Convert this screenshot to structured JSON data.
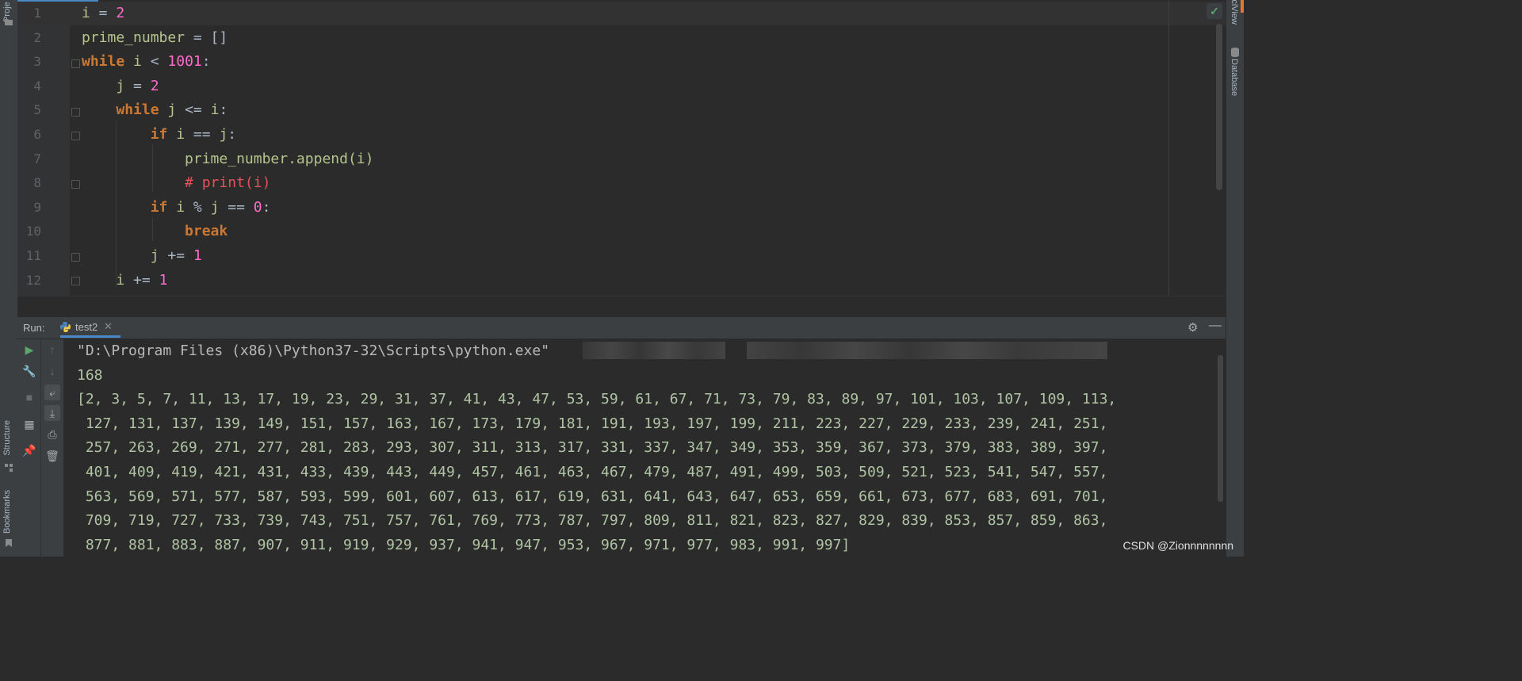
{
  "left_sidebar": {
    "project_label": "Project",
    "structure_label": "Structure",
    "bookmarks_label": "Bookmarks"
  },
  "right_sidebar": {
    "sciview_label": "SciView",
    "database_label": "Database"
  },
  "editor": {
    "lines": [
      {
        "number": "1",
        "tokens": [
          {
            "t": "i",
            "c": "var"
          },
          {
            "t": " = ",
            "c": ""
          },
          {
            "t": "2",
            "c": "num"
          }
        ]
      },
      {
        "number": "2",
        "tokens": [
          {
            "t": "prime_number",
            "c": "var"
          },
          {
            "t": " = []",
            "c": ""
          }
        ]
      },
      {
        "number": "3",
        "tokens": [
          {
            "t": "while",
            "c": "kw"
          },
          {
            "t": " ",
            "c": ""
          },
          {
            "t": "i",
            "c": "var"
          },
          {
            "t": " < ",
            "c": ""
          },
          {
            "t": "1001",
            "c": "num"
          },
          {
            "t": ":",
            "c": ""
          }
        ]
      },
      {
        "number": "4",
        "tokens": [
          {
            "t": "    ",
            "c": ""
          },
          {
            "t": "j",
            "c": "var"
          },
          {
            "t": " = ",
            "c": ""
          },
          {
            "t": "2",
            "c": "num"
          }
        ]
      },
      {
        "number": "5",
        "tokens": [
          {
            "t": "    ",
            "c": ""
          },
          {
            "t": "while",
            "c": "kw"
          },
          {
            "t": " ",
            "c": ""
          },
          {
            "t": "j",
            "c": "var"
          },
          {
            "t": " <= ",
            "c": ""
          },
          {
            "t": "i",
            "c": "var"
          },
          {
            "t": ":",
            "c": ""
          }
        ]
      },
      {
        "number": "6",
        "tokens": [
          {
            "t": "        ",
            "c": ""
          },
          {
            "t": "if",
            "c": "kw"
          },
          {
            "t": " ",
            "c": ""
          },
          {
            "t": "i",
            "c": "var"
          },
          {
            "t": " == ",
            "c": ""
          },
          {
            "t": "j",
            "c": "var"
          },
          {
            "t": ":",
            "c": ""
          }
        ]
      },
      {
        "number": "7",
        "tokens": [
          {
            "t": "            ",
            "c": ""
          },
          {
            "t": "prime_number.append(i)",
            "c": "var"
          }
        ]
      },
      {
        "number": "8",
        "tokens": [
          {
            "t": "            ",
            "c": ""
          },
          {
            "t": "# print(i)",
            "c": "cm"
          }
        ]
      },
      {
        "number": "9",
        "tokens": [
          {
            "t": "        ",
            "c": ""
          },
          {
            "t": "if",
            "c": "kw"
          },
          {
            "t": " ",
            "c": ""
          },
          {
            "t": "i",
            "c": "var"
          },
          {
            "t": " % ",
            "c": ""
          },
          {
            "t": "j",
            "c": "var"
          },
          {
            "t": " == ",
            "c": ""
          },
          {
            "t": "0",
            "c": "num"
          },
          {
            "t": ":",
            "c": ""
          }
        ]
      },
      {
        "number": "10",
        "tokens": [
          {
            "t": "            ",
            "c": ""
          },
          {
            "t": "break",
            "c": "kw"
          }
        ]
      },
      {
        "number": "11",
        "tokens": [
          {
            "t": "        ",
            "c": ""
          },
          {
            "t": "j",
            "c": "var"
          },
          {
            "t": " += ",
            "c": ""
          },
          {
            "t": "1",
            "c": "num"
          }
        ]
      },
      {
        "number": "12",
        "tokens": [
          {
            "t": "    ",
            "c": ""
          },
          {
            "t": "i",
            "c": "var"
          },
          {
            "t": " += ",
            "c": ""
          },
          {
            "t": "1",
            "c": "num"
          }
        ]
      }
    ]
  },
  "run_panel": {
    "label": "Run:",
    "tab_label": "test2",
    "console_lines": [
      "\"D:\\Program Files (x86)\\Python37-32\\Scripts\\python.exe\"",
      "168",
      "[2, 3, 5, 7, 11, 13, 17, 19, 23, 29, 31, 37, 41, 43, 47, 53, 59, 61, 67, 71, 73, 79, 83, 89, 97, 101, 103, 107, 109, 113,",
      " 127, 131, 137, 139, 149, 151, 157, 163, 167, 173, 179, 181, 191, 193, 197, 199, 211, 223, 227, 229, 233, 239, 241, 251,",
      " 257, 263, 269, 271, 277, 281, 283, 293, 307, 311, 313, 317, 331, 337, 347, 349, 353, 359, 367, 373, 379, 383, 389, 397,",
      " 401, 409, 419, 421, 431, 433, 439, 443, 449, 457, 461, 463, 467, 479, 487, 491, 499, 503, 509, 521, 523, 541, 547, 557,",
      " 563, 569, 571, 577, 587, 593, 599, 601, 607, 613, 617, 619, 631, 641, 643, 647, 653, 659, 661, 673, 677, 683, 691, 701,",
      " 709, 719, 727, 733, 739, 743, 751, 757, 761, 769, 773, 787, 797, 809, 811, 821, 823, 827, 829, 839, 853, 857, 859, 863,",
      " 877, 881, 883, 887, 907, 911, 919, 929, 937, 941, 947, 953, 967, 971, 977, 983, 991, 997]"
    ]
  },
  "watermark": "CSDN @Zionnnnnnnn",
  "icons": {
    "run": "play-icon",
    "wrench": "wrench-icon",
    "stop": "stop-icon",
    "layout": "layout-icon",
    "pin": "pin-icon",
    "up": "arrow-up-icon",
    "down": "arrow-down-icon",
    "wrap": "soft-wrap-icon",
    "scroll_end": "scroll-to-end-icon",
    "print": "print-icon",
    "trash": "trash-icon"
  },
  "colors": {
    "keyword": "#cc7832",
    "number": "#ff6bcb",
    "identifier": "#b5c48c",
    "comment": "#e8505a",
    "console_text": "#b0c4a4",
    "accent": "#4a88c7"
  }
}
